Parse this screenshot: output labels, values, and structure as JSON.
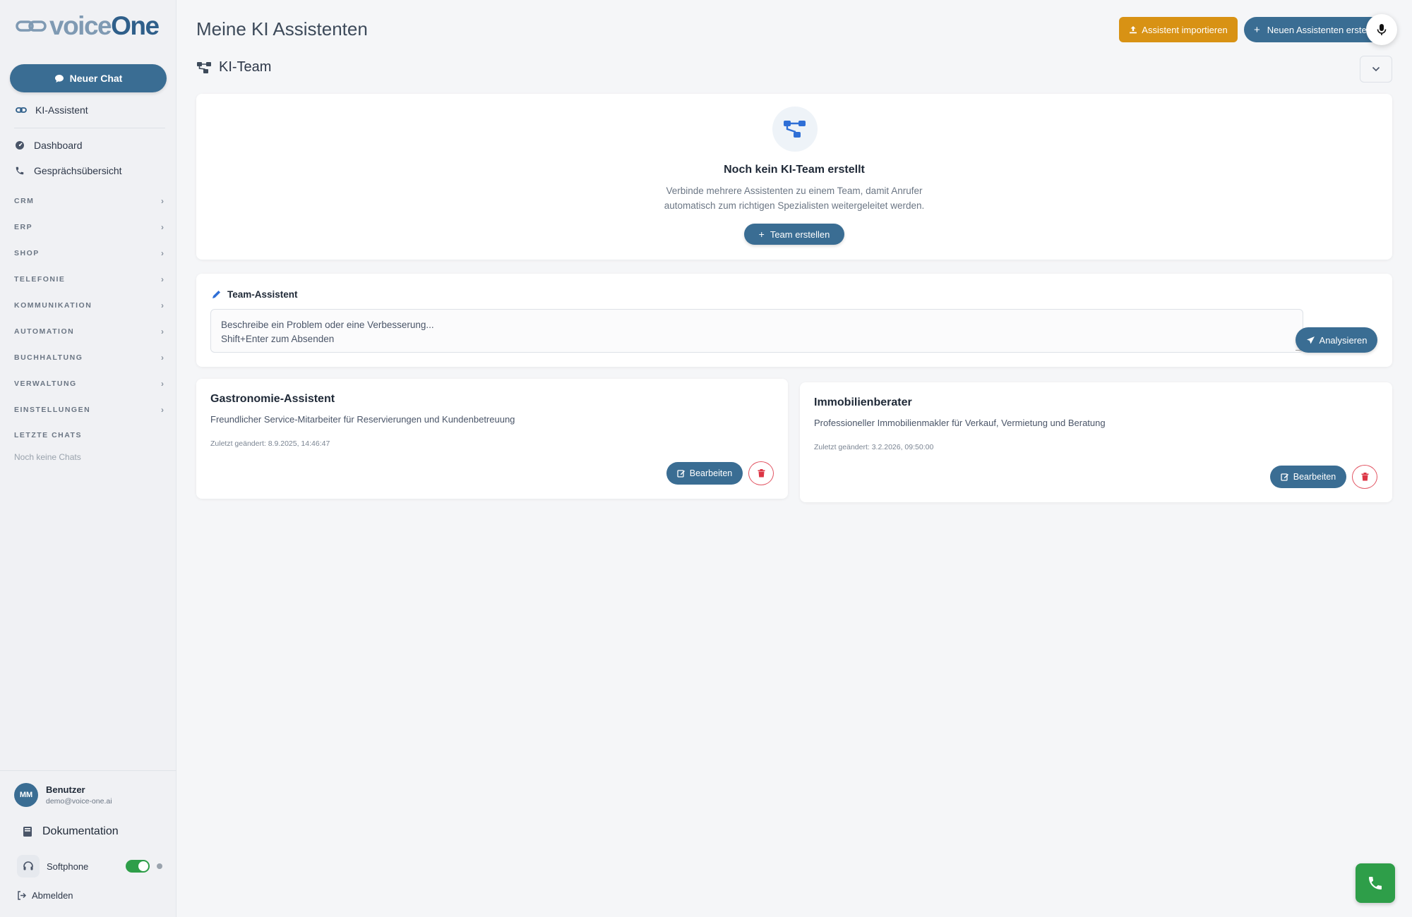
{
  "sidebar": {
    "logo": {
      "part1": "voice",
      "part2": "One"
    },
    "new_chat_label": "Neuer Chat",
    "assistant_label": "KI-Assistent",
    "nav": [
      {
        "label": "Dashboard",
        "icon": "dashboard-icon"
      },
      {
        "label": "Gesprächsübersicht",
        "icon": "phone-icon"
      }
    ],
    "sections": [
      "CRM",
      "ERP",
      "SHOP",
      "TELEFONIE",
      "KOMMUNIKATION",
      "AUTOMATION",
      "BUCHHALTUNG",
      "VERWALTUNG",
      "EINSTELLUNGEN"
    ],
    "recent_chats_label": "LETZTE CHATS",
    "no_chats_label": "Noch keine Chats",
    "user": {
      "initials": "MM",
      "name": "Benutzer",
      "email": "demo@voice-one.ai"
    },
    "documentation_label": "Dokumentation",
    "softphone_label": "Softphone",
    "softphone_enabled": true,
    "logout_label": "Abmelden"
  },
  "header": {
    "title": "Meine KI Assistenten",
    "import_label": "Assistent importieren",
    "new_label": "Neuen Assistenten erstellen"
  },
  "team": {
    "title": "KI-Team",
    "empty_title": "Noch kein KI-Team erstellt",
    "empty_desc_line1": "Verbinde mehrere Assistenten zu einem Team, damit Anrufer",
    "empty_desc_line2": "automatisch zum richtigen Spezialisten weitergeleitet werden.",
    "create_label": "Team erstellen"
  },
  "team_assistant": {
    "title": "Team-Assistent",
    "placeholder_line1": "Beschreibe ein Problem oder eine Verbesserung...",
    "placeholder_line2": "Shift+Enter zum Absenden",
    "analyze_label": "Analysieren"
  },
  "assistants": [
    {
      "name": "Gastronomie-Assistent",
      "description": "Freundlicher Service-Mitarbeiter für Reservierungen und Kundenbetreuung",
      "changed": "Zuletzt geändert: 8.9.2025, 14:46:47",
      "edit_label": "Bearbeiten"
    },
    {
      "name": "Immobilienberater",
      "description": "Professioneller Immobilienmakler für Verkauf, Vermietung und Beratung",
      "changed": "Zuletzt geändert: 3.2.2026, 09:50:00",
      "edit_label": "Bearbeiten"
    }
  ],
  "colors": {
    "primary": "#3a6d93",
    "import_accent": "#d89214",
    "danger": "#dc3545",
    "success": "#2e9e49"
  }
}
